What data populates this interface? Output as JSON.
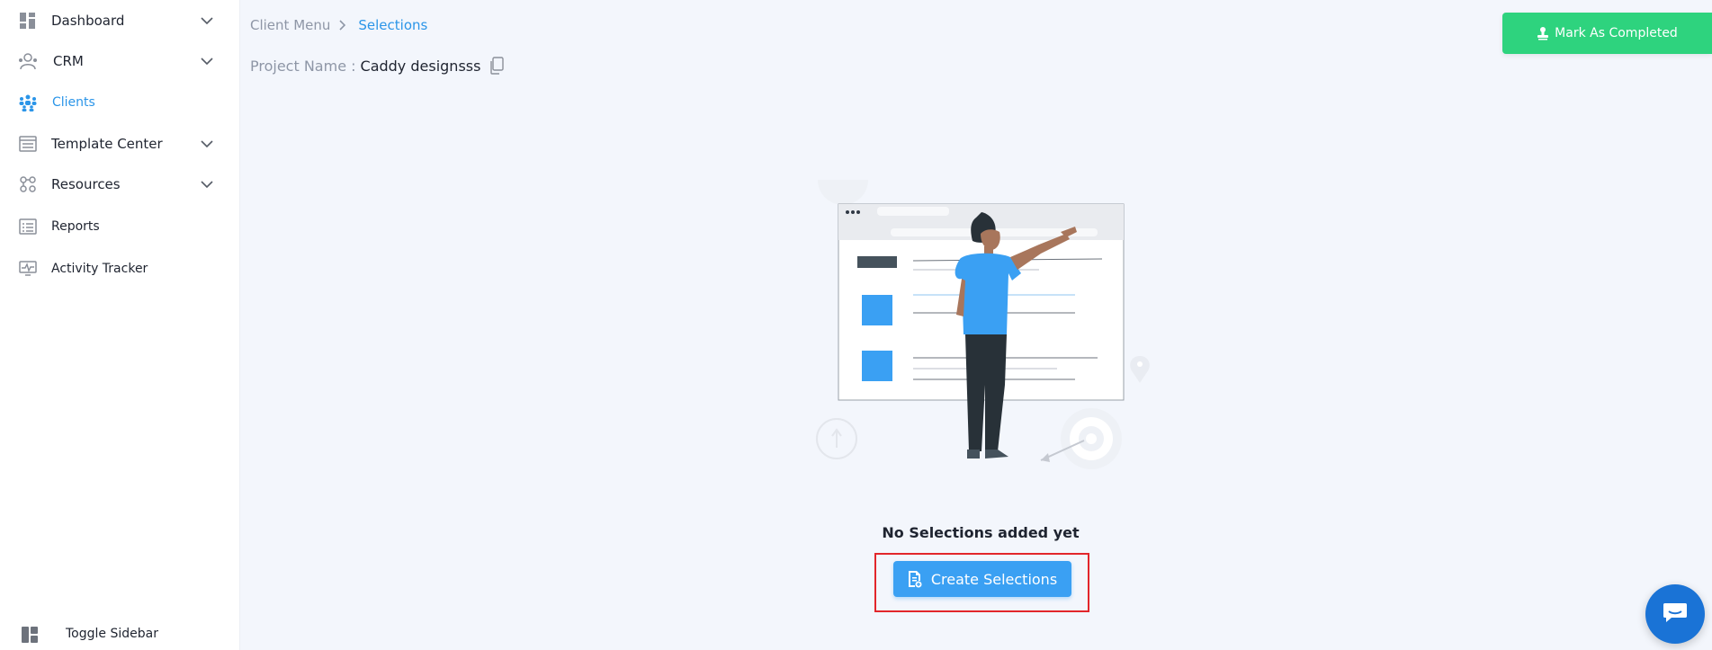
{
  "sidebar": {
    "items": [
      {
        "label": "Dashboard",
        "icon": "dashboard-icon",
        "has_chevron": true
      },
      {
        "label": "CRM",
        "icon": "crm-icon",
        "has_chevron": true
      },
      {
        "label": "Clients",
        "icon": "clients-icon",
        "active": true
      },
      {
        "label": "Template Center",
        "icon": "template-icon",
        "has_chevron": true
      },
      {
        "label": "Resources",
        "icon": "resources-icon",
        "has_chevron": true
      },
      {
        "label": "Reports",
        "icon": "reports-icon"
      },
      {
        "label": "Activity Tracker",
        "icon": "activity-icon"
      }
    ],
    "toggle_label": "Toggle Sidebar"
  },
  "breadcrumb": {
    "parent": "Client Menu",
    "current": "Selections"
  },
  "project": {
    "label": "Project Name :",
    "value": "Caddy designsss"
  },
  "header": {
    "mark_completed_label": "Mark As Completed"
  },
  "empty_state": {
    "message": "No Selections added yet",
    "create_label": "Create Selections"
  },
  "colors": {
    "accent": "#2b95e8",
    "success": "#2ed37e",
    "primary_button": "#3aa0f3",
    "highlight": "#e2262b",
    "chat": "#1a73d6"
  }
}
